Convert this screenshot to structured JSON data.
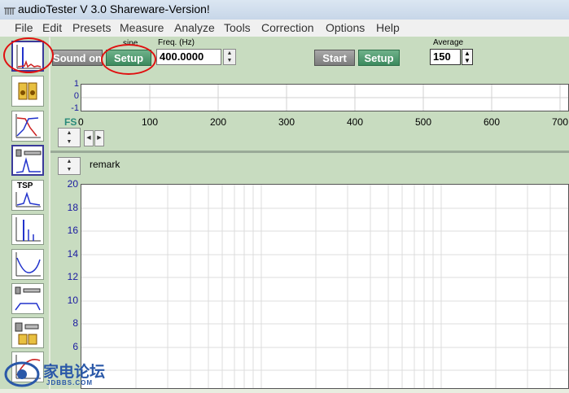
{
  "window": {
    "title": "audioTester  V 3.0 Shareware-Version!"
  },
  "menu": [
    "File",
    "Edit",
    "Presets",
    "Measure",
    "Analyze",
    "Tools",
    "Correction",
    "Options",
    "Help"
  ],
  "toolbar": {
    "sound_on_label": "Sound on",
    "sine_label": "sine",
    "setup_left_label": "Setup",
    "freq_label": "Freq. (Hz)",
    "freq_value": "400.0000",
    "start_label": "Start",
    "setup_right_label": "Setup",
    "average_label": "Average",
    "average_value": "150"
  },
  "sidebar_tools": [
    "spectrum-tool-icon",
    "speaker-tool-icon",
    "filter-response-tool-icon",
    "distortion-tool-icon",
    "tsp-tool-icon",
    "impulse-tool-icon",
    "impedance-tool-icon",
    "frequency-response-tool-icon",
    "driver-tool-icon",
    "phase-tool-icon"
  ],
  "tsp_label": "TSP",
  "top_plot": {
    "y_ticks": [
      "1",
      "0",
      "-1"
    ],
    "x_axis_label": "FS",
    "x_ticks": [
      "0",
      "100",
      "200",
      "300",
      "400",
      "500",
      "600",
      "700"
    ]
  },
  "remark_label": "remark",
  "main_plot": {
    "y_ticks": [
      "20",
      "18",
      "16",
      "14",
      "12",
      "10",
      "8",
      "6"
    ]
  },
  "watermark": {
    "text": "家电论坛",
    "sub": "JDBBS.COM"
  },
  "colors": {
    "panel": "#c8dcc0",
    "green_button": "#4d9a6e",
    "gray_button": "#8e8e8e",
    "annotation": "#e01010"
  }
}
